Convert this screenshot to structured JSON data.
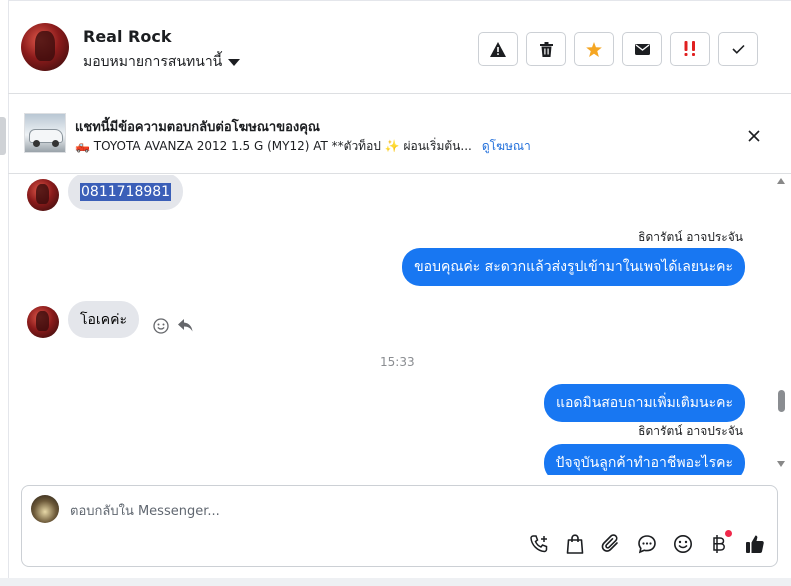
{
  "header": {
    "contact_name": "Real Rock",
    "assign_label": "มอบหมายการสนทนานี้",
    "buttons": [
      {
        "icon": "warning-icon",
        "color": "#1c1e21"
      },
      {
        "icon": "trash-icon",
        "color": "#1c1e21"
      },
      {
        "icon": "star-icon",
        "color": "#f5a623"
      },
      {
        "icon": "mail-icon",
        "color": "#1c1e21"
      },
      {
        "icon": "important-icon",
        "color": "#e02020"
      },
      {
        "icon": "check-icon",
        "color": "#1c1e21"
      }
    ]
  },
  "ad": {
    "title": "แชทนี้มีข้อความตอบกลับต่อโฆษณาของคุณ",
    "subtitle": "🛻 TOYOTA AVANZA 2012 1.5 G (MY12) AT **ตัวท็อป ✨ ผ่อนเริ่มต้น...",
    "link": "ดูโฆษณา"
  },
  "messages": {
    "phone": "0811718981",
    "sender1": "ธิดารัตน์ อาจประจัน",
    "out1": "ขอบคุณค่ะ สะดวกแล้วส่งรูปเข้ามาในเพจได้เลยนะคะ",
    "in2": "โอเคค่ะ",
    "time": "15:33",
    "out2": "แอดมินสอบถามเพิ่มเติมนะคะ",
    "sender2": "ธิดารัตน์ อาจประจัน",
    "out3": "ปัจจุบันลูกค้าทำอาชีพอะไรคะ"
  },
  "composer": {
    "placeholder": "ตอบกลับใน Messenger...",
    "tools": [
      "call-add-icon",
      "shopping-bag-icon",
      "attachment-icon",
      "chat-bubble-icon",
      "emoji-icon",
      "baht-icon",
      "thumbs-up-icon"
    ]
  },
  "colors": {
    "accent": "#1877f2",
    "incoming_bubble": "#e4e6eb",
    "link": "#216fdb"
  }
}
